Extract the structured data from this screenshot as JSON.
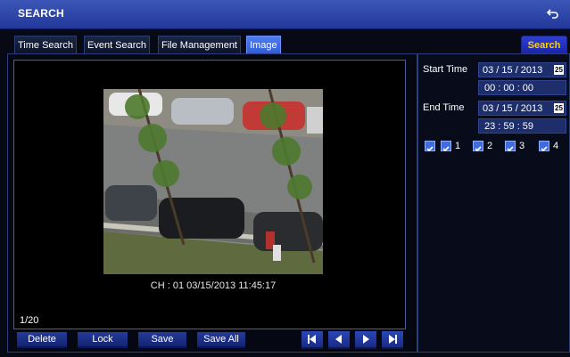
{
  "window": {
    "title": "SEARCH"
  },
  "tabs": [
    {
      "label": "Time Search"
    },
    {
      "label": "Event Search"
    },
    {
      "label": "File Management"
    },
    {
      "label": "Image"
    }
  ],
  "search_button": "Search",
  "snapshot": {
    "caption": "CH : 01  03/15/2013 11:45:17"
  },
  "page_counter": "1/20",
  "actions": {
    "delete": "Delete",
    "lock": "Lock",
    "save": "Save",
    "save_all": "Save All"
  },
  "start_time": {
    "label": "Start Time",
    "date": "03 / 15 / 2013",
    "time": "00  :  00  :  00",
    "calendar_badge": "25"
  },
  "end_time": {
    "label": "End Time",
    "date": "03 / 15 / 2013",
    "time": "23  :  59  :  59",
    "calendar_badge": "25"
  },
  "channels": [
    {
      "label": "",
      "checked": true
    },
    {
      "label": "1",
      "checked": true
    },
    {
      "label": "2",
      "checked": true
    },
    {
      "label": "3",
      "checked": true
    },
    {
      "label": "4",
      "checked": true
    }
  ],
  "colors": {
    "title_bar": "#2e47a8",
    "active_tab": "#3f6cdf",
    "search_text": "#ffd200"
  }
}
